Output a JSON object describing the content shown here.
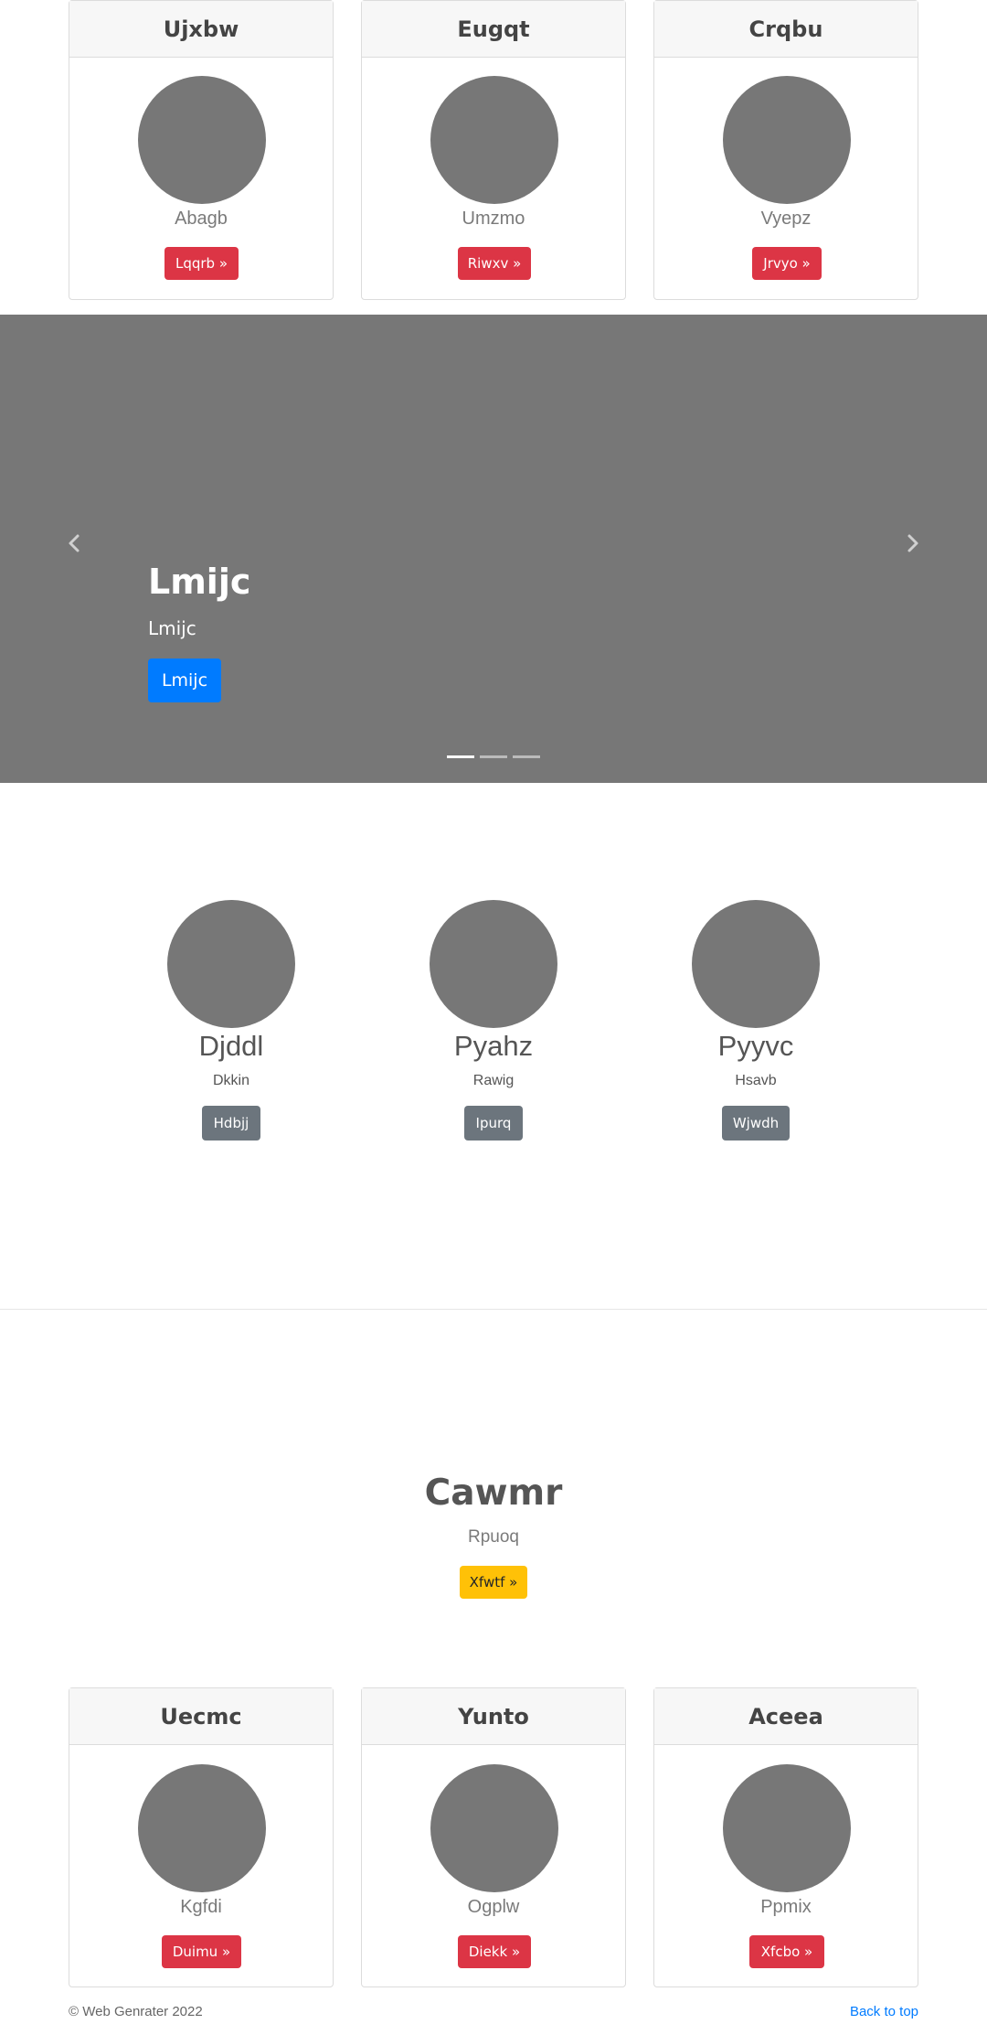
{
  "top_cards": [
    {
      "title": "Ujxbw",
      "subtitle": "Abagb",
      "button": "Lqqrb »"
    },
    {
      "title": "Eugqt",
      "subtitle": "Umzmo",
      "button": "Riwxv »"
    },
    {
      "title": "Crqbu",
      "subtitle": "Vyepz",
      "button": "Jrvyo »"
    }
  ],
  "carousel": {
    "title": "Lmijc",
    "subtitle": "Lmijc",
    "button": "Lmijc",
    "indicators": 3,
    "active_indicator": 1
  },
  "marketing": [
    {
      "title": "Djddl",
      "subtitle": "Dkkin",
      "button": "Hdbjj"
    },
    {
      "title": "Pyahz",
      "subtitle": "Rawig",
      "button": "Ipurq"
    },
    {
      "title": "Pyyvc",
      "subtitle": "Hsavb",
      "button": "Wjwdh"
    }
  ],
  "feature": {
    "title": "Cawmr",
    "subtitle": "Rpuoq",
    "button": "Xfwtf »"
  },
  "bottom_cards": [
    {
      "title": "Uecmc",
      "subtitle": "Kgfdi",
      "button": "Duimu »"
    },
    {
      "title": "Yunto",
      "subtitle": "Ogplw",
      "button": "Diekk »"
    },
    {
      "title": "Aceea",
      "subtitle": "Ppmix",
      "button": "Xfcbo »"
    }
  ],
  "footer": {
    "copyright": "© Web Genrater 2022",
    "back_to_top": "Back to top"
  },
  "colors": {
    "placeholder": "#777777",
    "danger": "#dc3545",
    "primary": "#007bff",
    "secondary": "#6c757d",
    "warning": "#ffc107"
  }
}
